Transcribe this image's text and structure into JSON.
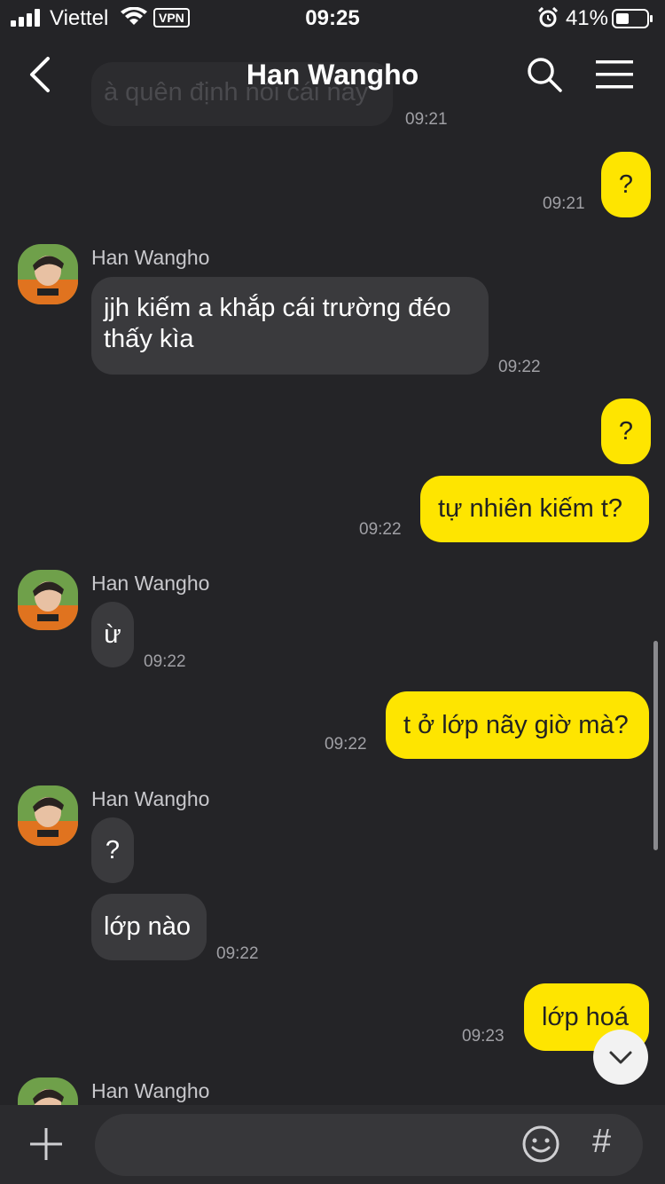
{
  "status": {
    "carrier": "Viettel",
    "vpn": "VPN",
    "time": "09:25",
    "battery": "41%"
  },
  "header": {
    "title": "Han Wangho"
  },
  "messages": {
    "m0": {
      "text": "à quên định nói cái này",
      "time": "09:21"
    },
    "m1": {
      "text": "?",
      "time": "09:21"
    },
    "g1": {
      "sender": "Han Wangho"
    },
    "m2": {
      "text": "jjh kiếm a khắp cái trường đéo thấy kìa",
      "time": "09:22"
    },
    "m3": {
      "text": "?"
    },
    "m4": {
      "text": "tự nhiên kiếm t?",
      "time": "09:22"
    },
    "g2": {
      "sender": "Han Wangho"
    },
    "m5": {
      "text": "ừ",
      "time": "09:22"
    },
    "m6": {
      "text": "t ở lớp nãy giờ mà?",
      "time": "09:22"
    },
    "g3": {
      "sender": "Han Wangho"
    },
    "m7": {
      "text": "?"
    },
    "m8": {
      "text": "lớp nào",
      "time": "09:22"
    },
    "m9": {
      "text": "lớp hoá",
      "time": "09:23"
    },
    "g4": {
      "sender": "Han Wangho"
    }
  },
  "input": {
    "placeholder": ""
  },
  "icons": {
    "back": "chevron-left-icon",
    "search": "search-icon",
    "menu": "hamburger-menu-icon",
    "plus": "plus-icon",
    "emoji": "smiley-icon",
    "hash": "#",
    "scroll_down": "chevron-down-icon"
  },
  "colors": {
    "background": "#242427",
    "incoming_bubble": "#3a3a3d",
    "outgoing_bubble": "#fee500"
  }
}
